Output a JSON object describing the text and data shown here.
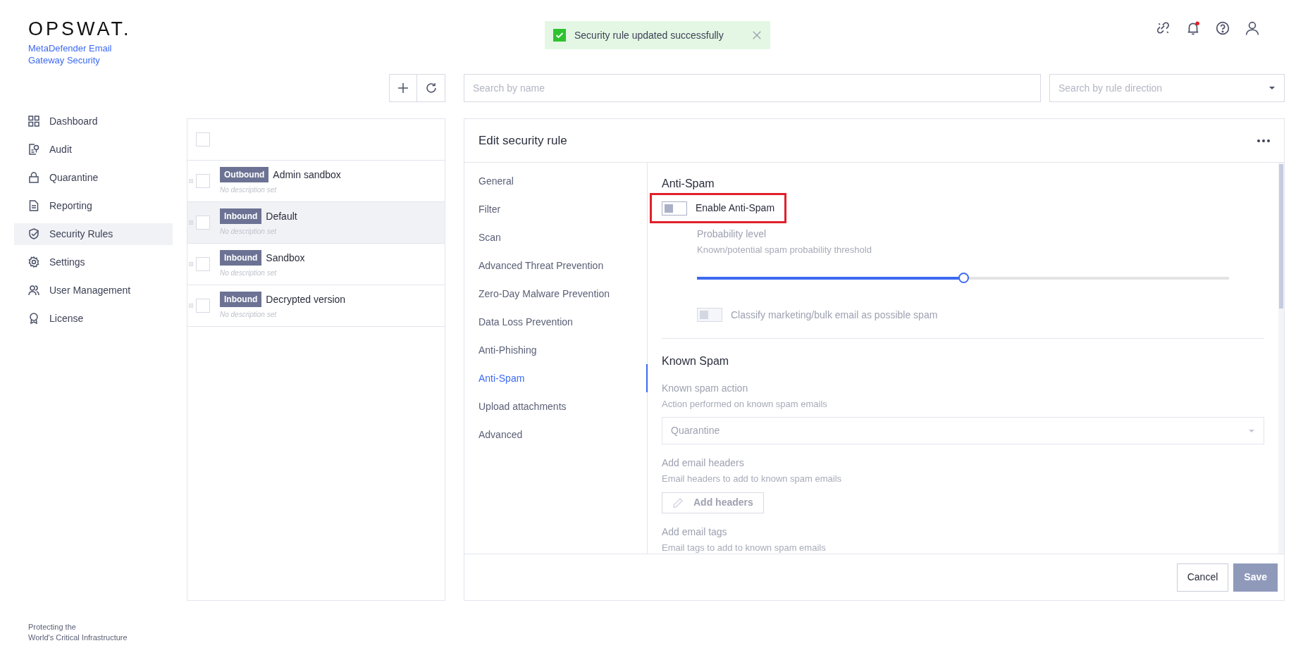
{
  "brand": {
    "logo": "OPSWAT.",
    "product": "MetaDefender Email Gateway Security"
  },
  "nav": [
    {
      "label": "Dashboard",
      "selected": false
    },
    {
      "label": "Audit",
      "selected": false
    },
    {
      "label": "Quarantine",
      "selected": false
    },
    {
      "label": "Reporting",
      "selected": false
    },
    {
      "label": "Security Rules",
      "selected": true
    },
    {
      "label": "Settings",
      "selected": false
    },
    {
      "label": "User Management",
      "selected": false
    },
    {
      "label": "License",
      "selected": false
    }
  ],
  "tagline": [
    "Protecting the",
    "World's Critical Infrastructure"
  ],
  "toast": {
    "kind": "success",
    "message": "Security rule updated successfully"
  },
  "search": {
    "placeholder": "Search by name"
  },
  "direction_filter": {
    "placeholder": "Search by rule direction"
  },
  "rules": {
    "select_all": {
      "checked": false
    },
    "items": [
      {
        "direction": "Outbound",
        "name": "Admin sandbox",
        "description": "No description set",
        "selected": false,
        "checked": false
      },
      {
        "direction": "Inbound",
        "name": "Default",
        "description": "No description set",
        "selected": true,
        "checked": false
      },
      {
        "direction": "Inbound",
        "name": "Sandbox",
        "description": "No description set",
        "selected": false,
        "checked": false
      },
      {
        "direction": "Inbound",
        "name": "Decrypted version",
        "description": "No description set",
        "selected": false,
        "checked": false
      }
    ]
  },
  "editor": {
    "title": "Edit security rule",
    "sections": [
      {
        "label": "General",
        "selected": false
      },
      {
        "label": "Filter",
        "selected": false
      },
      {
        "label": "Scan",
        "selected": false
      },
      {
        "label": "Advanced Threat Prevention",
        "selected": false
      },
      {
        "label": "Zero-Day Malware Prevention",
        "selected": false
      },
      {
        "label": "Data Loss Prevention",
        "selected": false
      },
      {
        "label": "Anti-Phishing",
        "selected": false
      },
      {
        "label": "Anti-Spam",
        "selected": true
      },
      {
        "label": "Upload attachments",
        "selected": false
      },
      {
        "label": "Advanced",
        "selected": false
      }
    ],
    "content": [
      {
        "kind": "heading",
        "text": "Anti-Spam"
      },
      {
        "kind": "toggle",
        "label": "Enable Anti-Spam",
        "on": false,
        "disabled": false,
        "highlighted": true,
        "children": [
          {
            "kind": "slider",
            "label": "Probability level",
            "hint": "Known/potential spam probability threshold",
            "level": 0.5,
            "disabled": true
          },
          {
            "kind": "toggle",
            "label": "Classify marketing/bulk email as possible spam",
            "on": false,
            "disabled": true,
            "highlighted": false
          }
        ]
      },
      {
        "kind": "divider"
      },
      {
        "kind": "heading",
        "text": "Known Spam"
      },
      {
        "kind": "select",
        "label": "Known spam action",
        "hint": "Action performed on known spam emails",
        "value": "Quarantine",
        "disabled": true
      },
      {
        "kind": "button",
        "label": "Add email headers",
        "hint": "Email headers to add to known spam emails",
        "button": "Add headers",
        "disabled": true
      },
      {
        "kind": "text",
        "label": "Add email tags",
        "hint": "Email tags to add to known spam emails",
        "disabled": true
      }
    ]
  },
  "actions": [
    {
      "label": "Cancel",
      "disabled": false
    },
    {
      "label": "Save",
      "disabled": true
    }
  ]
}
